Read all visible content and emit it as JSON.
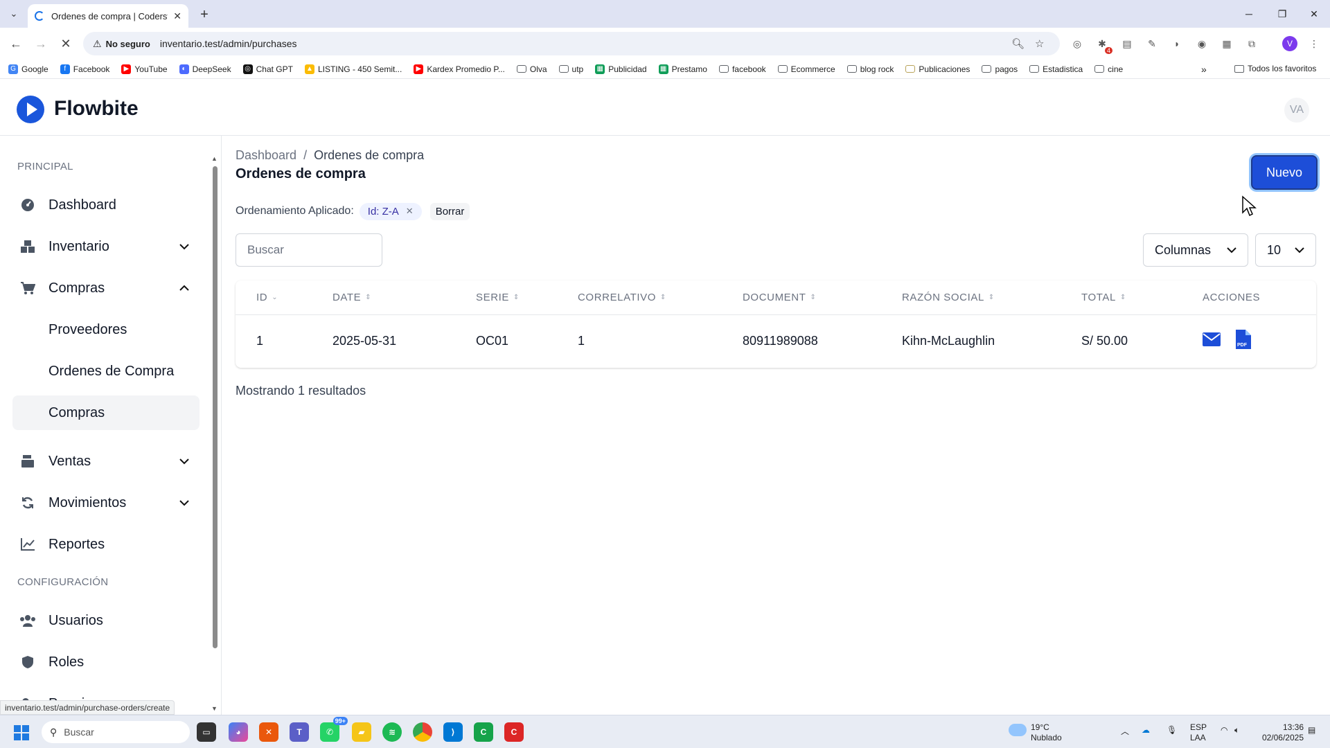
{
  "browser": {
    "tab_title": "Ordenes de compra | Codersfre",
    "url_warning": "No seguro",
    "url": "inventario.test/admin/purchases",
    "status_url": "inventario.test/admin/purchase-orders/create",
    "profile_initial": "V",
    "extension_badge": "4",
    "bookmarks": [
      {
        "label": "Google",
        "icon": "google-icon",
        "color": "#4285f4"
      },
      {
        "label": "Facebook",
        "icon": "facebook-icon",
        "color": "#1877f2"
      },
      {
        "label": "YouTube",
        "icon": "youtube-icon",
        "color": "#ff0000"
      },
      {
        "label": "DeepSeek",
        "icon": "deepseek-icon",
        "color": "#4d6bfe"
      },
      {
        "label": "Chat GPT",
        "icon": "chatgpt-icon",
        "color": "#111111"
      },
      {
        "label": "LISTING - 450 Semit...",
        "icon": "drive-icon",
        "color": "#fbbc04"
      },
      {
        "label": "Kardex Promedio P...",
        "icon": "youtube-icon",
        "color": "#ff0000"
      },
      {
        "label": "Olva",
        "icon": "folder-icon",
        "color": "#5f6368"
      },
      {
        "label": "utp",
        "icon": "folder-icon",
        "color": "#5f6368"
      },
      {
        "label": "Publicidad",
        "icon": "sheets-icon",
        "color": "#0f9d58"
      },
      {
        "label": "Prestamo",
        "icon": "sheets-icon",
        "color": "#0f9d58"
      },
      {
        "label": "facebook",
        "icon": "folder-icon",
        "color": "#5f6368"
      },
      {
        "label": "Ecommerce",
        "icon": "folder-icon",
        "color": "#5f6368"
      },
      {
        "label": "blog rock",
        "icon": "folder-icon",
        "color": "#5f6368"
      },
      {
        "label": "Publicaciones",
        "icon": "cloud-icon",
        "color": "#b8a35a"
      },
      {
        "label": "pagos",
        "icon": "folder-icon",
        "color": "#5f6368"
      },
      {
        "label": "Estadistica",
        "icon": "folder-icon",
        "color": "#5f6368"
      },
      {
        "label": "cine",
        "icon": "folder-icon",
        "color": "#5f6368"
      }
    ],
    "all_bookmarks": "Todos los favoritos"
  },
  "app": {
    "brand": "Flowbite",
    "avatar": "VA",
    "brand_color": "#1a56db"
  },
  "sidebar": {
    "section_principal": "PRINCIPAL",
    "section_config": "CONFIGURACIÓN",
    "items": {
      "dashboard": "Dashboard",
      "inventario": "Inventario",
      "compras": "Compras",
      "proveedores": "Proveedores",
      "ordenes": "Ordenes de Compra",
      "compras_sub": "Compras",
      "ventas": "Ventas",
      "movimientos": "Movimientos",
      "reportes": "Reportes",
      "usuarios": "Usuarios",
      "roles": "Roles",
      "permisos_partial": "Permisos"
    }
  },
  "main": {
    "breadcrumb_root": "Dashboard",
    "breadcrumb_current": "Ordenes de compra",
    "title": "Ordenes de compra",
    "new_button": "Nuevo",
    "sort_label": "Ordenamiento Aplicado:",
    "sort_chip": "Id: Z-A",
    "clear_label": "Borrar",
    "search_placeholder": "Buscar",
    "columns_label": "Columnas",
    "per_page": "10",
    "table": {
      "headers": [
        "ID",
        "DATE",
        "SERIE",
        "CORRELATIVO",
        "DOCUMENT",
        "RAZÓN SOCIAL",
        "TOTAL",
        "ACCIONES"
      ],
      "rows": [
        {
          "id": "1",
          "date": "2025-05-31",
          "serie": "OC01",
          "correlativo": "1",
          "document": "80911989088",
          "razon_social": "Kihn-McLaughlin",
          "total": "S/ 50.00"
        }
      ]
    },
    "results_text": "Mostrando 1 resultados"
  },
  "taskbar": {
    "search": "Buscar",
    "badge": "99+",
    "weather_temp": "19°C",
    "weather_desc": "Nublado",
    "lang1": "ESP",
    "lang2": "LAA",
    "time": "13:36",
    "date": "02/06/2025"
  }
}
